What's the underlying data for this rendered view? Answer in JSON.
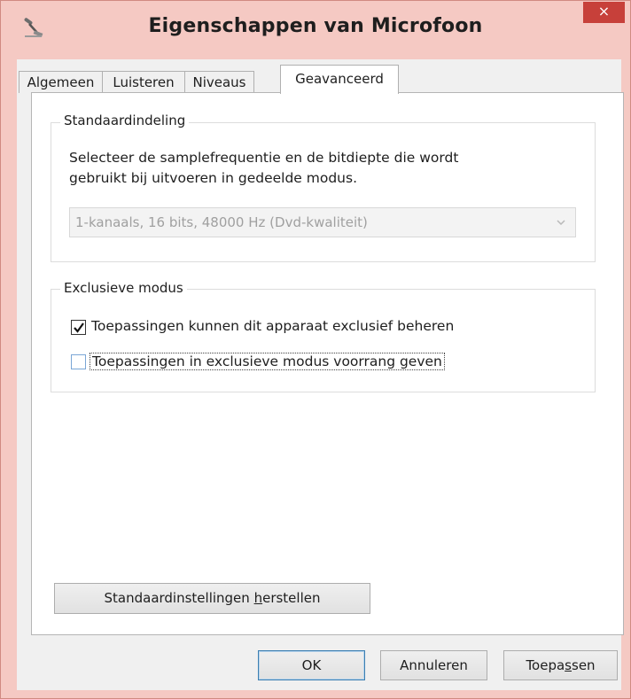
{
  "window": {
    "title": "Eigenschappen van Microfoon",
    "close_symbol": "×",
    "app_icon": "microphone-icon"
  },
  "tabs": [
    {
      "label": "Algemeen",
      "active": false
    },
    {
      "label": "Luisteren",
      "active": false
    },
    {
      "label": "Niveaus",
      "active": false
    },
    {
      "label": "Geavanceerd",
      "active": true
    }
  ],
  "default_format": {
    "group_label": "Standaardindeling",
    "description_line1": "Selecteer de samplefrequentie en de bitdiepte die wordt",
    "description_line2": "gebruikt bij uitvoeren in gedeelde modus.",
    "selected_value": "1-kanaals, 16 bits, 48000 Hz (Dvd-kwaliteit)",
    "enabled": false
  },
  "exclusive_mode": {
    "group_label": "Exclusieve modus",
    "options": [
      {
        "label": "Toepassingen kunnen dit apparaat exclusief beheren",
        "checked": true
      },
      {
        "label": "Toepassingen in exclusieve modus voorrang geven",
        "checked": false
      }
    ]
  },
  "restore_button": {
    "label_before": "Standaardinstellingen ",
    "label_accel": "h",
    "label_after": "erstellen"
  },
  "footer": {
    "ok": "OK",
    "cancel": "Annuleren",
    "apply_before": "Toepa",
    "apply_accel": "s",
    "apply_after": "sen"
  },
  "colors": {
    "frame": "#f5c9c3",
    "close_button": "#c7403a",
    "default_button_border": "#3c7fb1"
  }
}
